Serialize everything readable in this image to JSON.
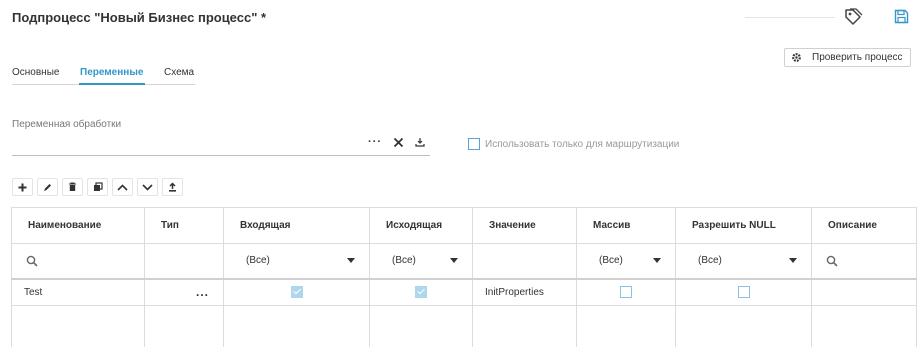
{
  "header": {
    "title": "Подпроцесс \"Новый Бизнес процесс\" *"
  },
  "actions": {
    "check_process_label": "Проверить процесс"
  },
  "tabs": [
    {
      "label": "Основные",
      "active": false
    },
    {
      "label": "Переменные",
      "active": true
    },
    {
      "label": "Схема",
      "active": false
    }
  ],
  "field": {
    "label": "Переменная обработки",
    "value": "",
    "more_label": "···"
  },
  "routing_checkbox": {
    "label": "Использовать только для маршрутизации",
    "checked": false
  },
  "toolbar": {
    "icons": [
      "add-icon",
      "edit-icon",
      "delete-icon",
      "copy-icon",
      "move-up-icon",
      "move-down-icon",
      "upload-icon"
    ]
  },
  "grid": {
    "columns": [
      "Наименование",
      "Тип",
      "Входящая",
      "Исходящая",
      "Значение",
      "Массив",
      "Разрешить NULL",
      "Описание"
    ],
    "filters": {
      "incoming": "(Все)",
      "outgoing": "(Все)",
      "array": "(Все)",
      "allow_null": "(Все)"
    },
    "rows": [
      {
        "name": "Test",
        "type_button": "...",
        "incoming": true,
        "outgoing": true,
        "value": "InitProperties",
        "array": false,
        "allow_null": false,
        "description": ""
      }
    ]
  },
  "colors": {
    "accent": "#3497c7",
    "checkbox_checked": "#aed6ec",
    "checkbox_border": "#8cc3e0"
  }
}
